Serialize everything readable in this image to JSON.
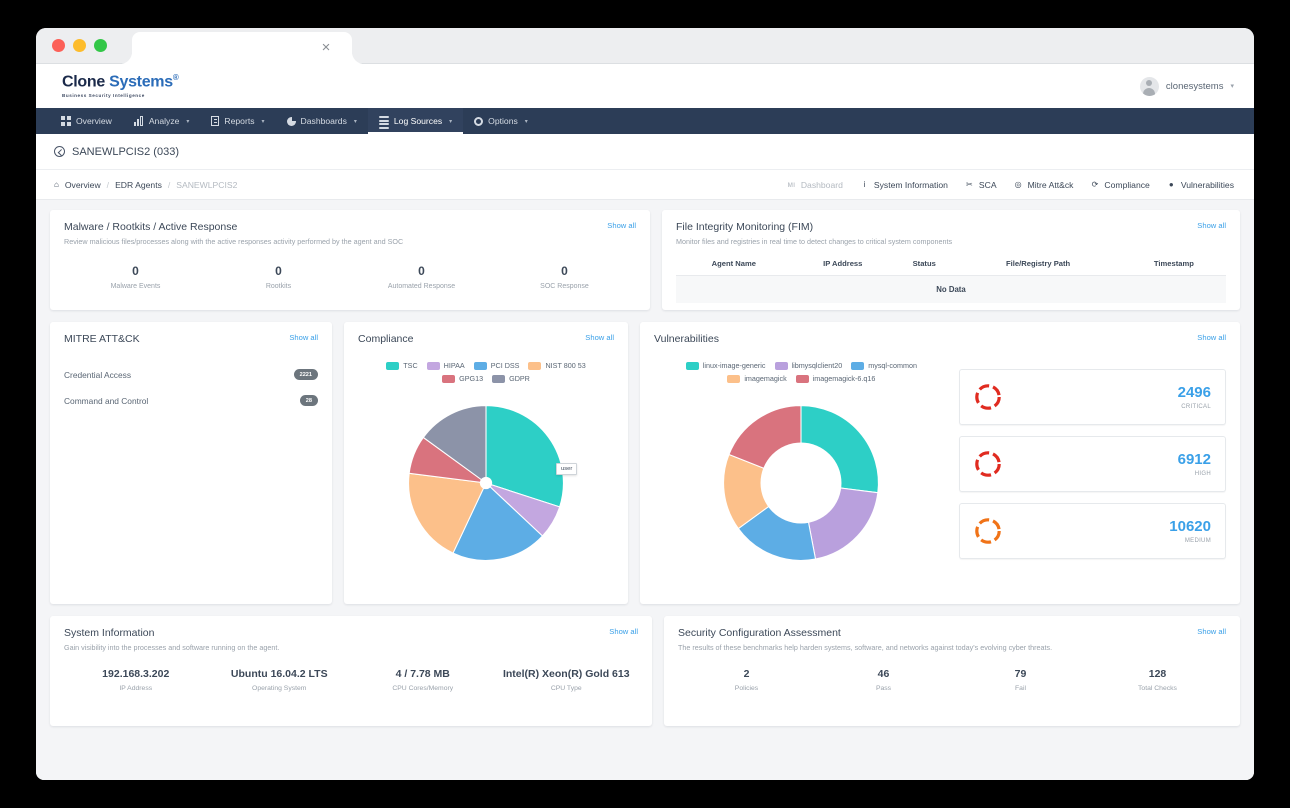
{
  "window": {
    "tab_close": "×"
  },
  "brand": {
    "logo_clone": "Clone",
    "logo_systems": "Systems",
    "logo_reg": "®",
    "logo_tagline": "Business Security Intelligence",
    "user_name": "clonesystems",
    "user_caret": "▾"
  },
  "nav": {
    "items": [
      {
        "label": "Overview",
        "icon": "grid-icon",
        "caret": "",
        "active": false
      },
      {
        "label": "Analyze",
        "icon": "bars-icon",
        "caret": "▾",
        "active": false
      },
      {
        "label": "Reports",
        "icon": "doc-icon",
        "caret": "▾",
        "active": false
      },
      {
        "label": "Dashboards",
        "icon": "pie-icon",
        "caret": "▾",
        "active": false
      },
      {
        "label": "Log Sources",
        "icon": "stack-icon",
        "caret": "▾",
        "active": true
      },
      {
        "label": "Options",
        "icon": "gear-icon",
        "caret": "▾",
        "active": false
      }
    ]
  },
  "agent_header": {
    "title": "SANEWLPCIS2 (033)"
  },
  "breadcrumb": {
    "home_icon": "⌂",
    "items": [
      "Overview",
      "EDR Agents",
      "SANEWLPCIS2"
    ],
    "separator": "/"
  },
  "subtabs": [
    {
      "label": "Dashboard",
      "icon": "ᴍı",
      "muted": true
    },
    {
      "label": "System Information",
      "icon": "i",
      "muted": false
    },
    {
      "label": "SCA",
      "icon": "✂",
      "muted": false
    },
    {
      "label": "Mitre Att&ck",
      "icon": "◎",
      "muted": false
    },
    {
      "label": "Compliance",
      "icon": "⟳",
      "muted": false
    },
    {
      "label": "Vulnerabilities",
      "icon": "●",
      "muted": false
    }
  ],
  "show_all": "Show all",
  "malware": {
    "title": "Malware / Rootkits / Active Response",
    "subtitle": "Review malicious files/processes along with the active responses activity performed by the agent and SOC",
    "stats": [
      {
        "value": "0",
        "label": "Malware Events"
      },
      {
        "value": "0",
        "label": "Rootkits"
      },
      {
        "value": "0",
        "label": "Automated Response"
      },
      {
        "value": "0",
        "label": "SOC Response"
      }
    ]
  },
  "fim": {
    "title": "File Integrity Monitoring (FIM)",
    "subtitle": "Monitor files and registries in real time to detect changes to critical system components",
    "columns": [
      "Agent Name",
      "IP Address",
      "Status",
      "File/Registry Path",
      "Timestamp"
    ],
    "empty_text": "No Data"
  },
  "mitre": {
    "title": "MITRE ATT&CK",
    "rows": [
      {
        "name": "Credential Access",
        "count": "2221"
      },
      {
        "name": "Command and Control",
        "count": "28"
      }
    ]
  },
  "compliance": {
    "title": "Compliance",
    "tooltip": "user",
    "chart_data": {
      "type": "pie",
      "title": "Compliance",
      "legend_position": "top",
      "categories": [
        "TSC",
        "HIPAA",
        "PCI DSS",
        "NIST 800 53",
        "GPG13",
        "GDPR"
      ],
      "values": [
        30,
        7,
        20,
        20,
        8,
        15
      ],
      "colors": [
        "#2dcfc6",
        "#c3a7e0",
        "#5dade5",
        "#fcc08a",
        "#d9737e",
        "#8c93a8"
      ],
      "annotations": [
        "user"
      ]
    }
  },
  "vulnerabilities": {
    "title": "Vulnerabilities",
    "chart_data": {
      "type": "pie",
      "title": "Vulnerabilities",
      "legend_position": "top",
      "categories": [
        "linux-image-generic",
        "libmysqlclient20",
        "mysql-common",
        "imagemagick",
        "imagemagick-6.q16"
      ],
      "values": [
        27,
        20,
        18,
        16,
        19
      ],
      "colors": [
        "#2dcfc6",
        "#b9a0dd",
        "#5dade5",
        "#fcc08a",
        "#d9737e"
      ]
    },
    "severity": [
      {
        "value": "2496",
        "label": "CRITICAL",
        "ring_color": "#e02b20"
      },
      {
        "value": "6912",
        "label": "HIGH",
        "ring_color": "#e02b20"
      },
      {
        "value": "10620",
        "label": "MEDIUM",
        "ring_color": "#f07318"
      }
    ]
  },
  "system_info": {
    "title": "System Information",
    "subtitle": "Gain visibility into the processes and software running on the agent.",
    "stats": [
      {
        "value": "192.168.3.202",
        "label": "IP Address"
      },
      {
        "value": "Ubuntu 16.04.2 LTS",
        "label": "Operating System"
      },
      {
        "value": "4 / 7.78 MB",
        "label": "CPU Cores/Memory"
      },
      {
        "value": "Intel(R) Xeon(R) Gold 613",
        "label": "CPU Type"
      }
    ]
  },
  "sca": {
    "title": "Security Configuration Assessment",
    "subtitle": "The results of these benchmarks help harden systems, software, and networks against today's evolving cyber threats.",
    "stats": [
      {
        "value": "2",
        "label": "Policies",
        "tone": ""
      },
      {
        "value": "46",
        "label": "Pass",
        "tone": "v-green"
      },
      {
        "value": "79",
        "label": "Fail",
        "tone": "v-red"
      },
      {
        "value": "128",
        "label": "Total Checks",
        "tone": ""
      }
    ]
  }
}
